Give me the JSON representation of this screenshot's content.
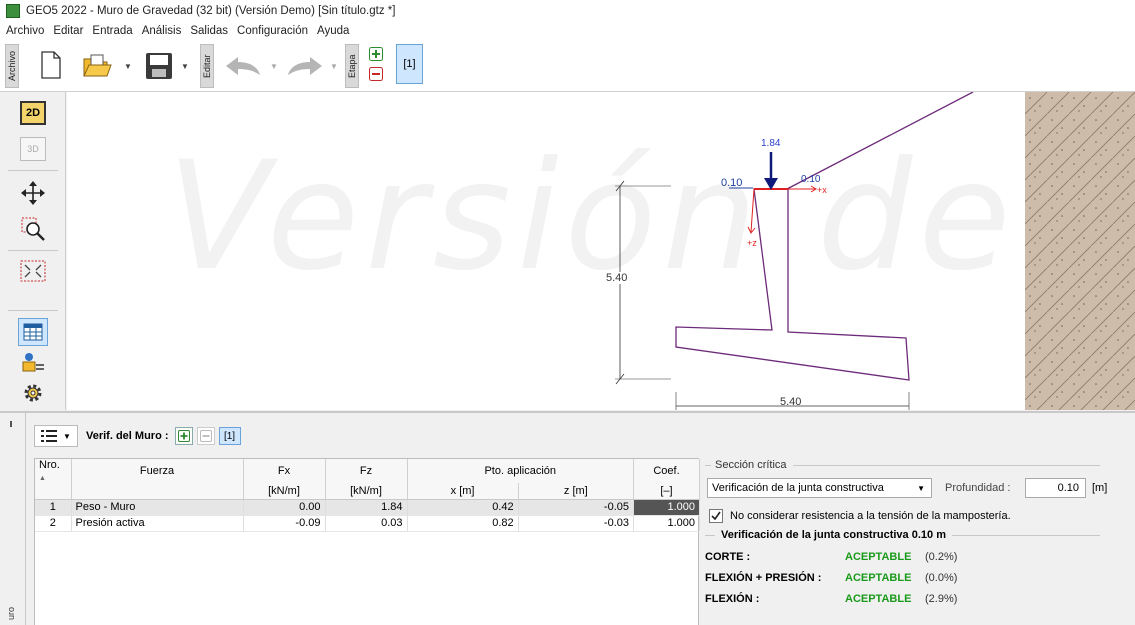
{
  "window": {
    "title": "GEO5 2022 - Muro de Gravedad (32 bit) (Versión Demo) [Sin título.gtz *]"
  },
  "menu": [
    "Archivo",
    "Editar",
    "Entrada",
    "Análisis",
    "Salidas",
    "Configuración",
    "Ayuda"
  ],
  "toolbar": {
    "archivo_label": "Archivo",
    "editar_label": "Editar",
    "etapa_label": "Etapa",
    "stage_label": "[1]"
  },
  "left_tools": {
    "btn_2d": "2D",
    "btn_3d": "3D"
  },
  "canvas": {
    "watermark": "Versión de",
    "force_label": "1.84",
    "left_offset_label": "0.10",
    "right_offset_label": "0.10",
    "x_axis_label": "+x",
    "z_axis_label": "+z",
    "height_dim": "5.40",
    "width_dim": "5.40"
  },
  "bottom": {
    "side_label": "uro",
    "verif_label": "Verif. del Muro :",
    "stage_label": "[1]"
  },
  "table": {
    "headers": {
      "nro": "Nro.",
      "fuerza": "Fuerza",
      "fx": "Fx",
      "fz": "Fz",
      "pto": "Pto. aplicación",
      "coef": "Coef.",
      "fx_unit": "[kN/m]",
      "fz_unit": "[kN/m]",
      "x_unit": "x [m]",
      "z_unit": "z [m]",
      "coef_unit": "[–]"
    },
    "rows": [
      {
        "nro": "1",
        "fuerza": "Peso - Muro",
        "fx": "0.00",
        "fz": "1.84",
        "x": "0.42",
        "z": "-0.05",
        "coef": "1.000"
      },
      {
        "nro": "2",
        "fuerza": "Presión activa",
        "fx": "-0.09",
        "fz": "0.03",
        "x": "0.82",
        "z": "-0.03",
        "coef": "1.000"
      }
    ]
  },
  "critical": {
    "title": "Sección crítica",
    "select_value": "Verificación de la junta constructiva",
    "depth_label": "Profundidad :",
    "depth_value": "0.10",
    "depth_unit": "[m]",
    "checkbox_label": "No considerar resistencia a la tensión de la mampostería.",
    "checkbox_checked": true,
    "verif_title": "Verificación de la junta constructiva 0.10 m",
    "results": [
      {
        "label": "CORTE :",
        "status": "ACEPTABLE",
        "pct": "(0.2%)"
      },
      {
        "label": "FLEXIÓN + PRESIÓN :",
        "status": "ACEPTABLE",
        "pct": "(0.0%)"
      },
      {
        "label": "FLEXIÓN :",
        "status": "ACEPTABLE",
        "pct": "(2.9%)"
      }
    ],
    "ok_color": "#1a9a1a"
  }
}
